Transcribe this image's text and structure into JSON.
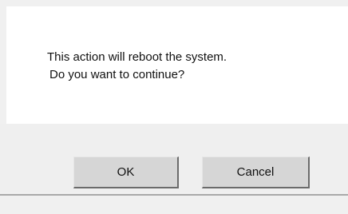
{
  "dialog": {
    "message_lines": [
      "This action will reboot the system.",
      "Do you want to continue?"
    ],
    "buttons": {
      "ok_label": "OK",
      "cancel_label": "Cancel"
    }
  }
}
